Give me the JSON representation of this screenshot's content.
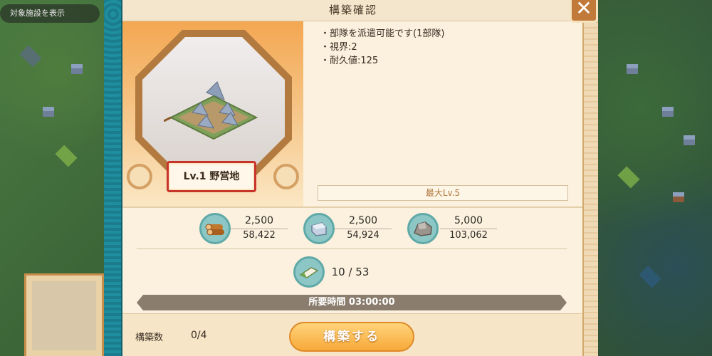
{
  "map": {
    "filter_label": "対象施設を表示"
  },
  "dialog": {
    "title": "構築確認",
    "close_label": "✕",
    "building": {
      "level_name": "Lv.1 野営地"
    },
    "info": [
      "・部隊を派遣可能です(1部隊)",
      "・視界:2",
      "・耐久値:125"
    ],
    "max_level": "最大Lv.5",
    "resources": [
      {
        "icon": "wood-icon",
        "cost": "2,500",
        "owned": "58,422"
      },
      {
        "icon": "iron-icon",
        "cost": "2,500",
        "owned": "54,924"
      },
      {
        "icon": "stone-icon",
        "cost": "5,000",
        "owned": "103,062"
      }
    ],
    "special_item": {
      "icon": "build-ticket-icon",
      "value": "10 / 53"
    },
    "time_required": "所要時間 03:00:00",
    "build_count_label": "構築数",
    "build_count_value": "0/4",
    "build_button_label": "構築する"
  }
}
